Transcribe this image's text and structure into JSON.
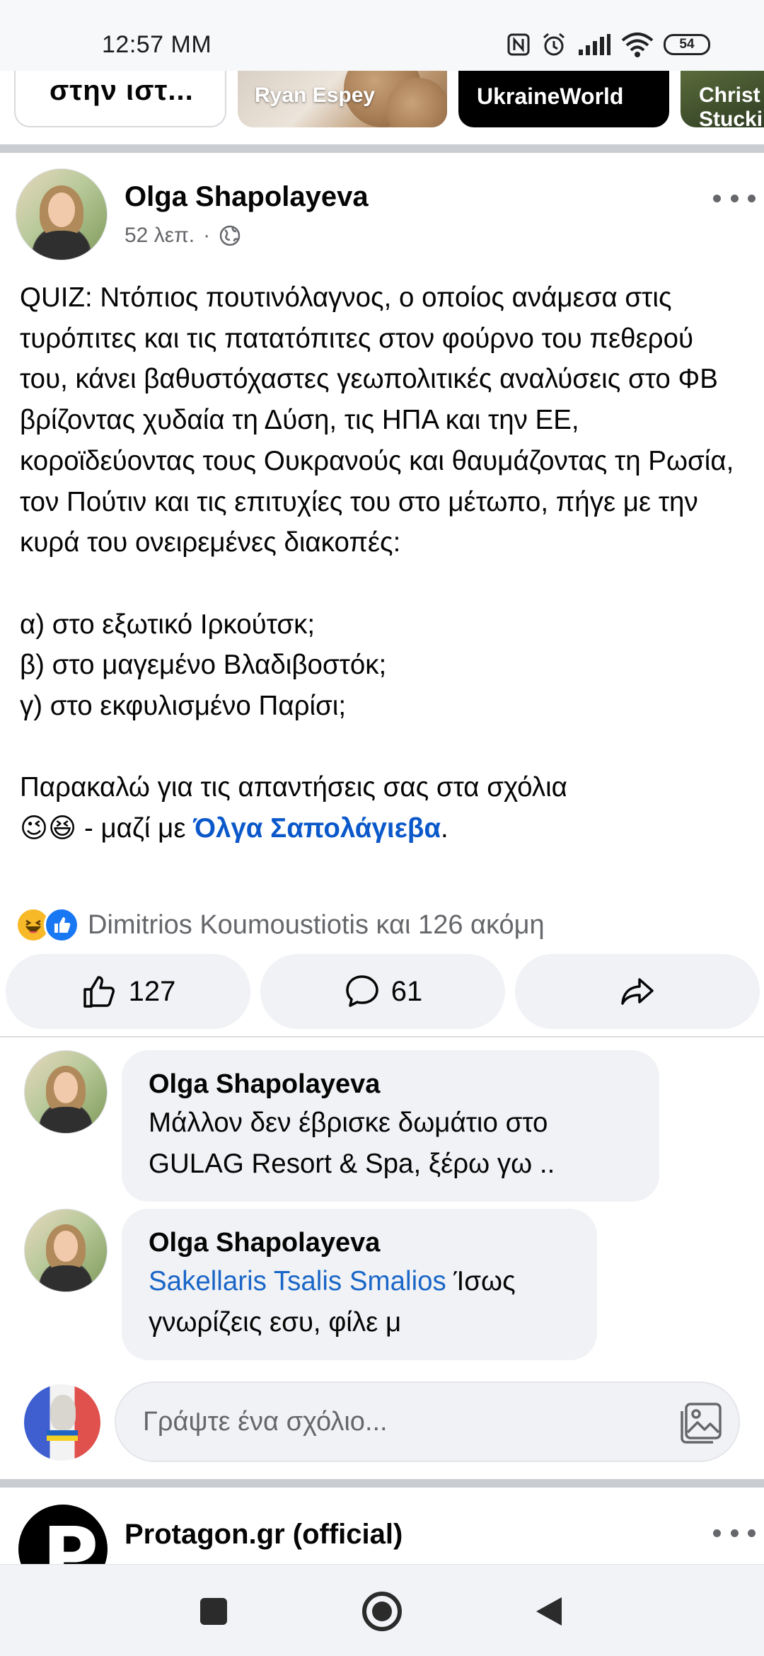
{
  "status_bar": {
    "time": "12:57 ΜΜ",
    "battery": "54",
    "icons": [
      "nfc-icon",
      "alarm-icon",
      "signal-icon",
      "wifi-icon",
      "battery-icon"
    ]
  },
  "stories": [
    {
      "label": "στην ιστ..."
    },
    {
      "label": "Ryan Espey"
    },
    {
      "label": "UkraineWorld"
    },
    {
      "label": "Christ Stucki"
    }
  ],
  "post": {
    "author": "Olga Shapolayeva",
    "time": "52 λεπ.",
    "separator": "·",
    "visibility_icon": "globe-icon",
    "text": "QUIZ: Ντόπιος πουτινόλαγνος, ο οποίος ανάμεσα στις τυρόπιτες και τις πατατόπιτες στον φούρνο του πεθερού του, κάνει βαθυστόχαστες γεωπολιτικές αναλύσεις στο ΦΒ βρίζοντας χυδαία τη Δύση, τις ΗΠΑ και την ΕΕ, κοροϊδεύοντας τους Ουκρανούς και θαυμάζοντας τη Ρωσία, τον Πούτιν και τις επιτυχίες του στο μέτωπο, πήγε με την κυρά του ονειρεμένες διακοπές:\n\nα) στο εξωτικό Ιρκούτσκ;\nβ) στο μαγεμένο Βλαδιβοστόκ;\nγ) στο εκφυλισμένο Παρίσι;\n\nΠαρακαλώ για τις απαντήσεις σας στα σχόλια\n",
    "emoji_line": "😉😆",
    "with_text": " - μαζί με ",
    "mention": "Όλγα Σαπολάγιεβα",
    "end": ".",
    "reactions_text": "Dimitrios Koumoustiotis και 126 ακόμη",
    "like_count": "127",
    "comment_count": "61"
  },
  "comments": [
    {
      "author": "Olga Shapolayeva",
      "text": "Μάλλον δεν έβρισκε δωμάτιο στο GULAG Resort & Spa, ξέρω γω .."
    },
    {
      "author": "Olga Shapolayeva",
      "tag": "Sakellaris Tsalis Smalios",
      "text": " Ίσως γνωρίζεις εσυ, φίλε μ"
    }
  ],
  "composer": {
    "placeholder": "Γράψτε ένα σχόλιο..."
  },
  "next_post": {
    "author": "Protagon.gr (official)",
    "avatar_letter": "P"
  },
  "colors": {
    "link": "#0a58ca",
    "secondary_text": "#65676b",
    "bubble": "#f0f2f5"
  }
}
